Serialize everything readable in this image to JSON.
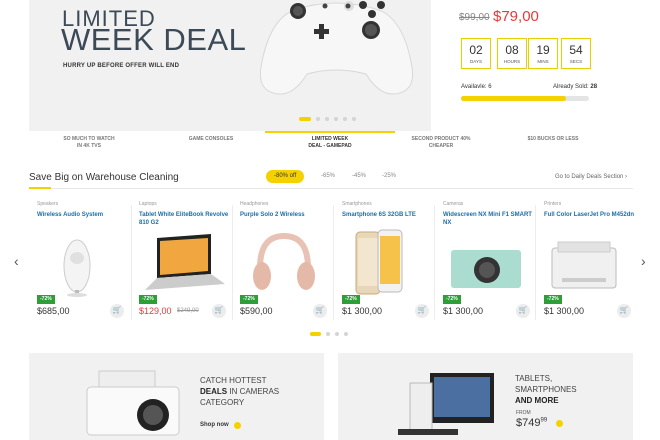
{
  "hero": {
    "title_line1": "LIMITED",
    "title_line2": "WEEK DEAL",
    "subtitle": "HURRY UP BEFORE OFFER WILL END",
    "old_price": "$99,00",
    "new_price": "$79,00",
    "countdown": [
      {
        "value": "02",
        "label": "DAYS"
      },
      {
        "value": "08",
        "label": "HOURS"
      },
      {
        "value": "19",
        "label": "MINS"
      },
      {
        "value": "54",
        "label": "SECS"
      }
    ],
    "available_label": "Availavle: 6",
    "sold_label": "Already Sold:",
    "sold_value": "28",
    "sold_fraction": 0.82,
    "slide_count": 6,
    "active_slide": 0
  },
  "hero_tabs": [
    {
      "line1": "SO MUCH TO WATCH",
      "line2": "IN 4K TVS"
    },
    {
      "line1": "GAME CONSOLES",
      "line2": ""
    },
    {
      "line1": "LIMITED WEEK",
      "line2": "DEAL - GAMEPAD"
    },
    {
      "line1": "SECOND PRODUCT 40%",
      "line2": "CHEAPER"
    },
    {
      "line1": "$10 BUCKS OR LESS",
      "line2": ""
    }
  ],
  "deals_section": {
    "title": "Save Big on Warehouse Cleaning",
    "filters": [
      "-80% off",
      "-65%",
      "-45%",
      "-25%"
    ],
    "active_filter": 0,
    "go_link": "Go to Daily Deals Section ›"
  },
  "products": [
    {
      "category": "Speakers",
      "name": "Wireless Audio System",
      "badge": "-72%",
      "price": "$685,00",
      "old_price": "",
      "icon": "speaker-icon"
    },
    {
      "category": "Laptops",
      "name": "Tablet White EliteBook Revolve 810 G2",
      "badge": "-72%",
      "price": "$129,00",
      "old_price": "$249,00",
      "icon": "laptop-icon"
    },
    {
      "category": "Headphones",
      "name": "Purple Solo 2 Wireless",
      "badge": "-72%",
      "price": "$590,00",
      "old_price": "",
      "icon": "headphones-icon"
    },
    {
      "category": "Smartphones",
      "name": "Smartphone 6S 32GB LTE",
      "badge": "-72%",
      "price": "$1 300,00",
      "old_price": "",
      "icon": "smartphone-icon"
    },
    {
      "category": "Cameras",
      "name": "Widescreen NX Mini F1 SMART NX",
      "badge": "-72%",
      "price": "$1 300,00",
      "old_price": "",
      "icon": "camera-icon"
    },
    {
      "category": "Printers",
      "name": "Full Color LaserJet Pro M452dn",
      "badge": "-72%",
      "price": "$1 300,00",
      "old_price": "",
      "icon": "printer-icon"
    }
  ],
  "product_pager": {
    "count": 4,
    "active": 0
  },
  "banners": [
    {
      "line1": "CATCH HOTTEST",
      "bold": "DEALS",
      "line2_rest": " IN CAMERAS",
      "line3": "CATEGORY",
      "cta": "Shop now"
    },
    {
      "line1": "TABLETS,",
      "line2": "SMARTPHONES",
      "bold": "AND MORE",
      "from": "FROM",
      "price": "$749",
      "cents": "99"
    }
  ],
  "colors": {
    "accent": "#f5d100",
    "sale_red": "#e23b3b",
    "badge_green": "#2e9e37",
    "link_blue": "#1a6fa8"
  }
}
